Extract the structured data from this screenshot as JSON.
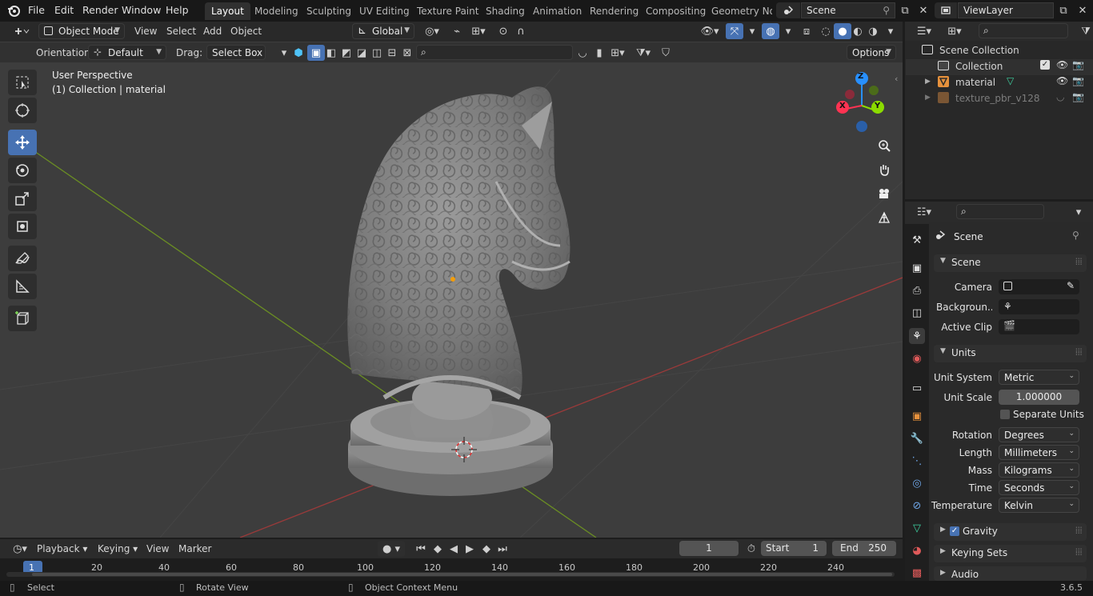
{
  "menu": {
    "items": [
      "File",
      "Edit",
      "Render",
      "Window",
      "Help"
    ],
    "workspaces": [
      "Layout",
      "Modeling",
      "Sculpting",
      "UV Editing",
      "Texture Paint",
      "Shading",
      "Animation",
      "Rendering",
      "Compositing",
      "Geometry Noc"
    ],
    "active_workspace": "Layout",
    "scene": "Scene",
    "view_layer": "ViewLayer"
  },
  "viewport_header": {
    "mode": "Object Mode",
    "menus": [
      "View",
      "Select",
      "Add",
      "Object"
    ],
    "transform_orientation": "Global",
    "orientation_label": "Orientation:",
    "orientation_value": "Default",
    "drag_label": "Drag:",
    "drag_value": "Select Box",
    "options_label": "Options"
  },
  "viewport": {
    "perspective": "User Perspective",
    "collection_info": "(1) Collection | material",
    "gizmo_axes": [
      "Z",
      "Y",
      "X"
    ]
  },
  "outliner": {
    "root": "Scene Collection",
    "items": [
      {
        "label": "Collection",
        "kind": "collection"
      },
      {
        "label": "material",
        "kind": "mesh"
      },
      {
        "label": "texture_pbr_v128",
        "kind": "mesh",
        "dimmed": true
      }
    ]
  },
  "properties": {
    "title": "Scene",
    "scene_panel": {
      "header": "Scene",
      "camera_label": "Camera",
      "background_label": "Backgroun...",
      "active_clip_label": "Active Clip"
    },
    "units_panel": {
      "header": "Units",
      "unit_system_label": "Unit System",
      "unit_system": "Metric",
      "unit_scale_label": "Unit Scale",
      "unit_scale": "1.000000",
      "separate_units": "Separate Units",
      "rotation_label": "Rotation",
      "rotation": "Degrees",
      "length_label": "Length",
      "length": "Millimeters",
      "mass_label": "Mass",
      "mass": "Kilograms",
      "time_label": "Time",
      "time": "Seconds",
      "temperature_label": "Temperature",
      "temperature": "Kelvin"
    },
    "gravity": "Gravity",
    "keying_sets": "Keying Sets",
    "audio": "Audio"
  },
  "timeline": {
    "menus": [
      "Playback",
      "Keying",
      "View",
      "Marker"
    ],
    "current_frame": "1",
    "start_label": "Start",
    "start": "1",
    "end_label": "End",
    "end": "250",
    "ruler": [
      "1",
      "20",
      "40",
      "60",
      "80",
      "100",
      "120",
      "140",
      "160",
      "180",
      "200",
      "220",
      "240"
    ]
  },
  "status_bar": {
    "select": "Select",
    "rotate": "Rotate View",
    "context": "Object Context Menu",
    "version": "3.6.5"
  },
  "colors": {
    "accent": "#4772b3",
    "axis_x": "#ff3352",
    "axis_y": "#8bdc00",
    "axis_z": "#2890ff",
    "viewport_bg": "#3d3d3d"
  }
}
